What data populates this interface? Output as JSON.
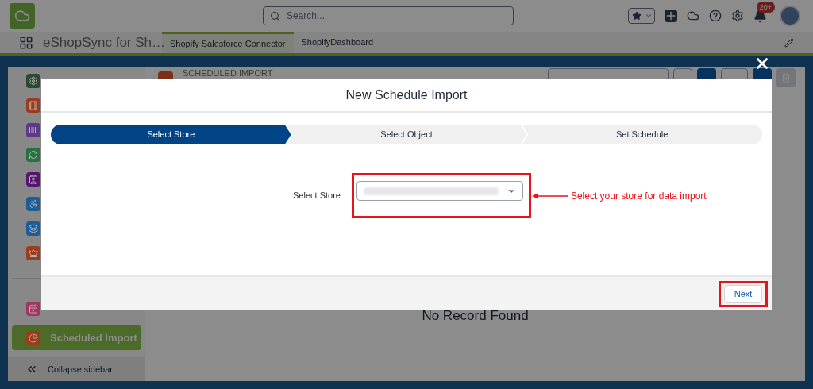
{
  "header": {
    "search": {
      "placeholder": "Search..."
    },
    "notification_badge": "20+"
  },
  "nav": {
    "app_name": "eShopSync for Sh…",
    "tabs": [
      {
        "label": "Shopify Salesforce Connector",
        "selected": true
      },
      {
        "label": "ShopifyDashboard",
        "selected": false
      }
    ]
  },
  "sidebar": {
    "items": [
      {
        "color": "#2a4a31",
        "selected": false
      },
      {
        "color": "#9c3c1d",
        "selected": false
      },
      {
        "color": "#60378b",
        "selected": false
      },
      {
        "color": "#28723f",
        "selected": false
      },
      {
        "color": "#561571",
        "selected": false
      },
      {
        "color": "#1d5d96",
        "selected": false
      },
      {
        "color": "#1d5d96",
        "selected": false
      },
      {
        "color": "#9c3c1d",
        "selected": false
      }
    ],
    "bottom_items": [
      {
        "color": "#a23561",
        "selected": false
      },
      {
        "color": "#9c3c1d",
        "label": "Scheduled Import",
        "selected": true
      }
    ],
    "collapse": "Collapse sidebar"
  },
  "main": {
    "title": "SCHEDULED IMPORT",
    "empty_message": "No Record Found"
  },
  "modal": {
    "title": "New Schedule Import",
    "steps": [
      {
        "label": "Select Store",
        "selected": true
      },
      {
        "label": "Select Object",
        "selected": false
      },
      {
        "label": "Set Schedule",
        "selected": false
      }
    ],
    "store_field": {
      "label": "Select Store"
    },
    "annotation": "Select your store for data import",
    "next_button": "Next"
  }
}
